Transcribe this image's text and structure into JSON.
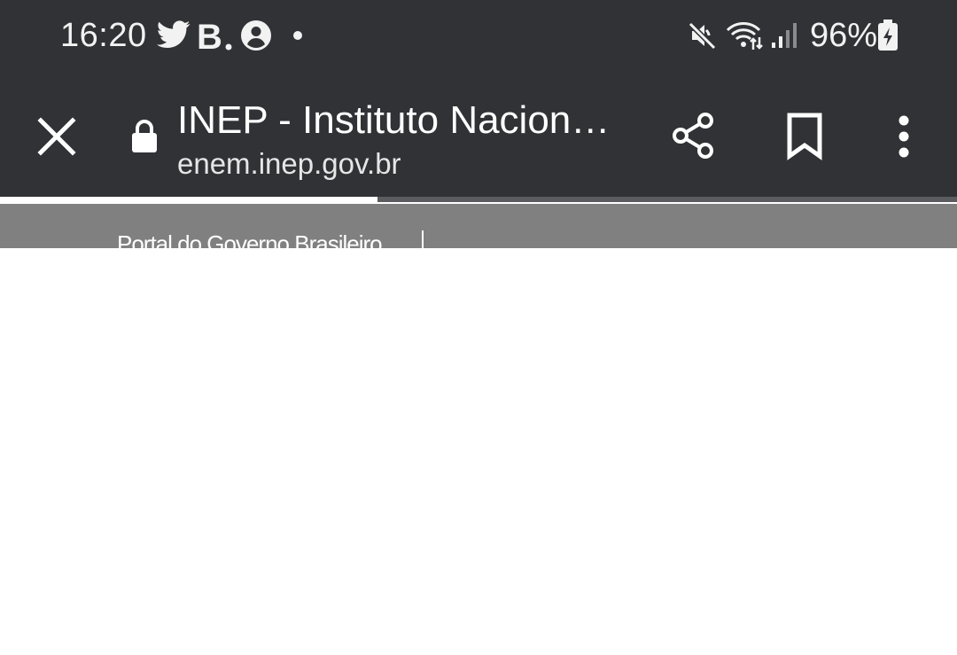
{
  "status_bar": {
    "time": "16:20",
    "battery_percent": "96%",
    "left_icons": [
      "twitter-icon",
      "b-app-icon",
      "account-icon",
      "dot-icon"
    ],
    "right_icons": [
      "mute-icon",
      "wifi-icon",
      "signal-icon",
      "battery-charging-icon"
    ]
  },
  "toolbar": {
    "title": "INEP - Instituto Nacion…",
    "domain": "enem.inep.gov.br",
    "icons": [
      "close-icon",
      "lock-icon",
      "share-icon",
      "bookmark-icon",
      "more-vert-icon"
    ]
  },
  "page_load_progress": 0.394,
  "page": {
    "gov_bar_link": "Portal do Governo Brasileiro"
  },
  "colors": {
    "chrome_background": "#313236",
    "gov_bar": "#808080",
    "progress_fill": "#ffffff",
    "progress_track": "#5b5c60"
  }
}
